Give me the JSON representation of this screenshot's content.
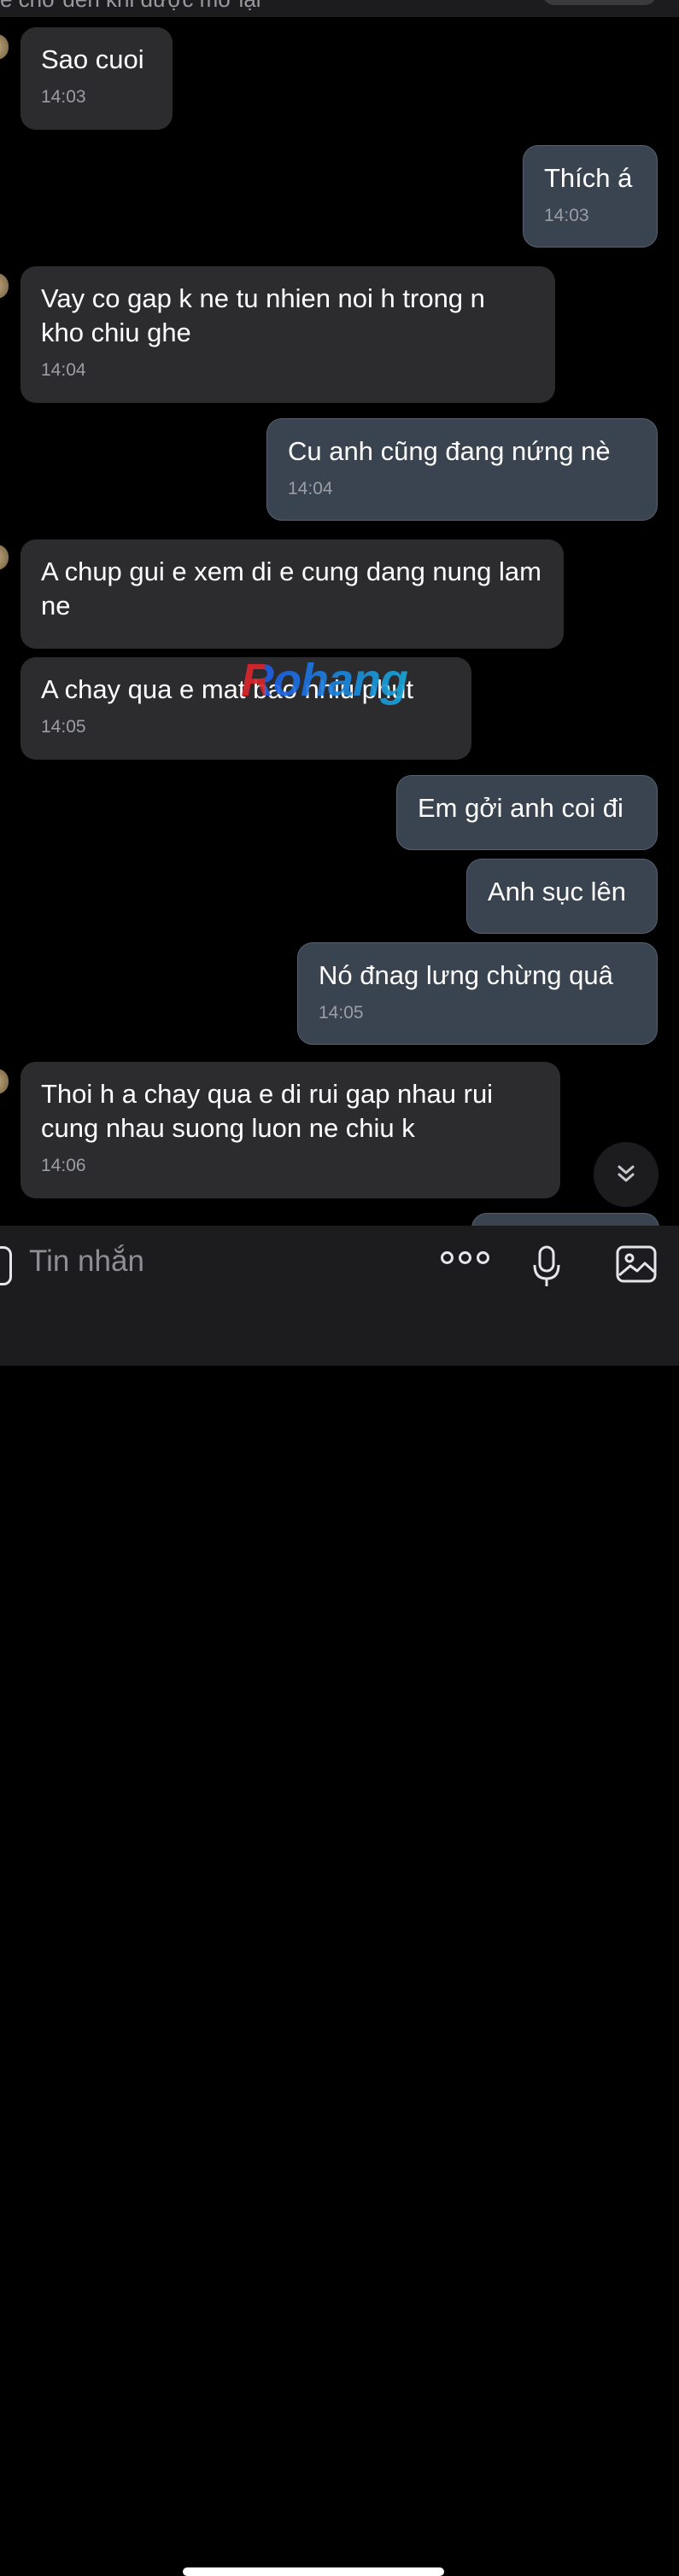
{
  "header": {
    "banner_text": "ẽ chờ đến khi được mở lại"
  },
  "messages": [
    {
      "side": "in",
      "text": "Sao cuoi",
      "time": "14:03"
    },
    {
      "side": "out",
      "text": "Thích á",
      "time": "14:03"
    },
    {
      "side": "in",
      "text": "Vay co gap k ne tu nhien noi h trong n kho chiu ghe",
      "time": "14:04"
    },
    {
      "side": "out",
      "text": "Cu anh cũng đang nứng nè",
      "time": "14:04"
    },
    {
      "side": "in",
      "text": "A chup gui e xem di e cung dang nung lam ne"
    },
    {
      "side": "in",
      "text": "A chay qua e mat bao nhiu phut",
      "time": "14:05"
    },
    {
      "side": "out",
      "text": "Em gởi anh coi đi"
    },
    {
      "side": "out",
      "text": "Anh sục lên"
    },
    {
      "side": "out",
      "text": "Nó đnag lưng chừng quâ",
      "time": "14:05"
    },
    {
      "side": "in",
      "text": "Thoi h a chay qua e di rui gap nhau rui cung nhau suong luon ne chiu k",
      "time": "14:06"
    }
  ],
  "watermark": "Rohang",
  "composer": {
    "placeholder": "Tin nhắn",
    "icons": [
      "more-icon",
      "microphone-icon",
      "image-icon"
    ]
  },
  "scroll_button": {
    "icon": "chevrons-down-icon"
  }
}
